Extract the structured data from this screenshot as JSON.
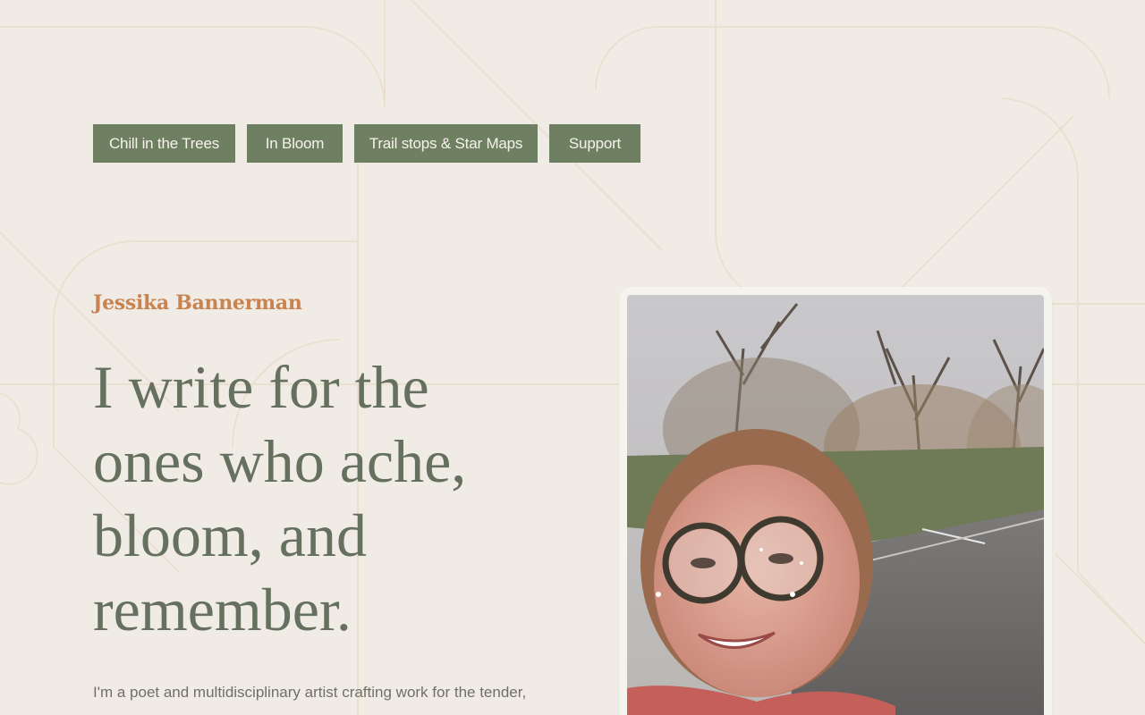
{
  "nav": {
    "items": [
      {
        "label": "Chill in the Trees"
      },
      {
        "label": "In Bloom"
      },
      {
        "label": "Trail stops & Star Maps"
      },
      {
        "label": "Support"
      }
    ]
  },
  "hero": {
    "author": "Jessika Bannerman",
    "headline": "I write for the ones who ache, bloom, and remember.",
    "intro": "I'm a poet and multidisciplinary artist crafting work for the tender,"
  },
  "colors": {
    "background": "#f0ece5",
    "nav_button": "#6f8062",
    "accent": "#c98350",
    "headline": "#66705f"
  },
  "photo": {
    "icon": "portrait-photo"
  }
}
